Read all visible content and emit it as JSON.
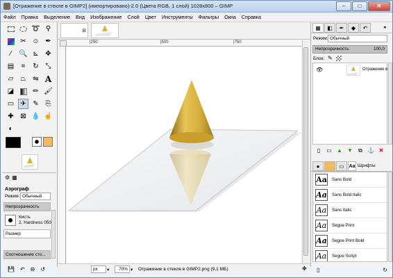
{
  "window": {
    "title": "[Отражение в стекле в GIMP2] (импортировано)-2.0 (Цвета RGB, 1 слой) 1028x800 – GIMP",
    "min_label": "–",
    "max_label": "□",
    "close_label": "✕"
  },
  "menu": [
    "Файл",
    "Правка",
    "Выделение",
    "Вид",
    "Изображение",
    "Слой",
    "Цвет",
    "Инструменты",
    "Фильтры",
    "Окна",
    "Справка"
  ],
  "toolbox": {
    "tool_icons": [
      "rect-select-icon",
      "ellipse-select-icon",
      "free-select-icon",
      "fuzzy-select-icon",
      "color-select-icon",
      "scissors-icon",
      "foreground-select-icon",
      "paths-icon",
      "color-picker-icon",
      "zoom-icon",
      "measure-icon",
      "move-icon",
      "align-icon",
      "crop-icon",
      "rotate-icon",
      "scale-icon",
      "shear-icon",
      "perspective-icon",
      "flip-icon",
      "text-icon",
      "bucket-fill-icon",
      "blend-icon",
      "pencil-icon",
      "paintbrush-icon",
      "eraser-icon",
      "airbrush-icon",
      "ink-icon",
      "clone-icon",
      "heal-icon",
      "perspective-clone-icon",
      "blur-icon",
      "smudge-icon",
      "dodge-icon"
    ],
    "fg_color": "#000000",
    "bg_color": "#ffffff",
    "options_title": "Аэрограф",
    "mode_label": "Режим:",
    "mode_value": "Обычный",
    "opacity_label": "Непрозрачность",
    "brush_label": "Кисть",
    "brush_value": "2. Hardness 050",
    "size_label": "Размер",
    "ratio_label": "Соотношение сто..."
  },
  "canvas": {
    "ruler_marks": [
      "|250",
      "|500",
      "|750"
    ],
    "zoom_unit": "px",
    "zoom_value": "70%",
    "status_text": "Отражение в стекле в GIMP2.png (9,1 МБ)"
  },
  "layers": {
    "mode_label": "Режим:",
    "mode_value": "Обычный",
    "opacity_label": "Непрозрачность",
    "opacity_value": "100,0",
    "lock_label": "Блок:",
    "layer_name": "Отражение в с"
  },
  "fonts": {
    "tab_label": "Шрифты",
    "items": [
      "Sans Bold",
      "Sans Bold Italic",
      "Sans Italic",
      "Segoe Print",
      "Segoe Print Bold",
      "Segoe Script"
    ]
  }
}
